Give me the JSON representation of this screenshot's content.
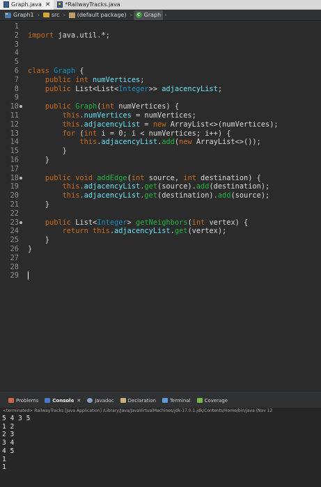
{
  "window": {
    "tabs": [
      {
        "label": "Graph.java",
        "icon": "java-file-icon",
        "active": true
      },
      {
        "label": "*RailwayTracks.java",
        "icon": "java-file-icon",
        "active": false
      }
    ]
  },
  "breadcrumb": [
    "Graph1",
    "src",
    "(default package)",
    "Graph"
  ],
  "editor": {
    "line_numbers": [
      "1",
      "2",
      "3",
      "4",
      "5",
      "6",
      "7",
      "8",
      "9",
      "10",
      "11",
      "12",
      "13",
      "14",
      "15",
      "16",
      "17",
      "18",
      "19",
      "20",
      "21",
      "22",
      "23",
      "24",
      "25",
      "26",
      "27",
      "28",
      "29"
    ],
    "lines": [
      [],
      [
        [
          "kw",
          "import"
        ],
        [
          "t",
          " java.util.*;"
        ]
      ],
      [],
      [],
      [],
      [
        [
          "kw",
          "class"
        ],
        [
          "t",
          " "
        ],
        [
          "typ",
          "Graph"
        ],
        [
          "t",
          " {"
        ]
      ],
      [
        [
          "t",
          "    "
        ],
        [
          "kw",
          "public"
        ],
        [
          "t",
          " "
        ],
        [
          "kw",
          "int"
        ],
        [
          "t",
          " "
        ],
        [
          "fld",
          "numVertices"
        ],
        [
          "t",
          ";"
        ]
      ],
      [
        [
          "t",
          "    "
        ],
        [
          "kw",
          "public"
        ],
        [
          "t",
          " List<List<"
        ],
        [
          "typ",
          "Integer"
        ],
        [
          "t",
          ">> "
        ],
        [
          "fld",
          "adjacencyList"
        ],
        [
          "t",
          ";"
        ]
      ],
      [],
      [
        [
          "t",
          "    "
        ],
        [
          "kw",
          "public"
        ],
        [
          "t",
          " "
        ],
        [
          "mth",
          "Graph"
        ],
        [
          "t",
          "("
        ],
        [
          "kw",
          "int"
        ],
        [
          "t",
          " numVertices) {"
        ]
      ],
      [
        [
          "t",
          "        "
        ],
        [
          "kw",
          "this"
        ],
        [
          "t",
          "."
        ],
        [
          "fld",
          "numVertices"
        ],
        [
          "t",
          " = numVertices;"
        ]
      ],
      [
        [
          "t",
          "        "
        ],
        [
          "kw",
          "this"
        ],
        [
          "t",
          "."
        ],
        [
          "fld",
          "adjacencyList"
        ],
        [
          "t",
          " = "
        ],
        [
          "kw",
          "new"
        ],
        [
          "t",
          " ArrayList<>(numVertices);"
        ]
      ],
      [
        [
          "t",
          "        "
        ],
        [
          "kw",
          "for"
        ],
        [
          "t",
          " ("
        ],
        [
          "kw",
          "int"
        ],
        [
          "t",
          " i = 0; i < numVertices; i++) {"
        ]
      ],
      [
        [
          "t",
          "            "
        ],
        [
          "kw",
          "this"
        ],
        [
          "t",
          "."
        ],
        [
          "fld",
          "adjacencyList"
        ],
        [
          "t",
          "."
        ],
        [
          "mth",
          "add"
        ],
        [
          "t",
          "("
        ],
        [
          "kw",
          "new"
        ],
        [
          "t",
          " ArrayList<>());"
        ]
      ],
      [
        [
          "t",
          "        }"
        ]
      ],
      [
        [
          "t",
          "    }"
        ]
      ],
      [],
      [
        [
          "t",
          "    "
        ],
        [
          "kw",
          "public"
        ],
        [
          "t",
          " "
        ],
        [
          "kw",
          "void"
        ],
        [
          "t",
          " "
        ],
        [
          "mth",
          "addEdge"
        ],
        [
          "t",
          "("
        ],
        [
          "kw",
          "int"
        ],
        [
          "t",
          " source, "
        ],
        [
          "kw",
          "int"
        ],
        [
          "t",
          " destination) {"
        ]
      ],
      [
        [
          "t",
          "        "
        ],
        [
          "kw",
          "this"
        ],
        [
          "t",
          "."
        ],
        [
          "fld",
          "adjacencyList"
        ],
        [
          "t",
          "."
        ],
        [
          "mth",
          "get"
        ],
        [
          "t",
          "(source)."
        ],
        [
          "mth",
          "add"
        ],
        [
          "t",
          "(destination);"
        ]
      ],
      [
        [
          "t",
          "        "
        ],
        [
          "kw",
          "this"
        ],
        [
          "t",
          "."
        ],
        [
          "fld",
          "adjacencyList"
        ],
        [
          "t",
          "."
        ],
        [
          "mth",
          "get"
        ],
        [
          "t",
          "(destination)."
        ],
        [
          "mth",
          "add"
        ],
        [
          "t",
          "(source);"
        ]
      ],
      [
        [
          "t",
          "    }"
        ]
      ],
      [],
      [
        [
          "t",
          "    "
        ],
        [
          "kw",
          "public"
        ],
        [
          "t",
          " List<"
        ],
        [
          "typ",
          "Integer"
        ],
        [
          "t",
          "> "
        ],
        [
          "mth",
          "getNeighbors"
        ],
        [
          "t",
          "("
        ],
        [
          "kw",
          "int"
        ],
        [
          "t",
          " vertex) {"
        ]
      ],
      [
        [
          "t",
          "        "
        ],
        [
          "kw",
          "return"
        ],
        [
          "t",
          " "
        ],
        [
          "kw",
          "this"
        ],
        [
          "t",
          "."
        ],
        [
          "fld",
          "adjacencyList"
        ],
        [
          "t",
          "."
        ],
        [
          "mth",
          "get"
        ],
        [
          "t",
          "(vertex);"
        ]
      ],
      [
        [
          "t",
          "    }"
        ]
      ],
      [
        [
          "t",
          "}"
        ]
      ],
      [],
      [],
      []
    ],
    "fold_markers": [
      10,
      18,
      23
    ],
    "caret_line": 29
  },
  "console": {
    "tabs": [
      {
        "label": "Problems",
        "icon": "problems-icon",
        "active": false
      },
      {
        "label": "Console",
        "icon": "console-icon",
        "active": true
      },
      {
        "label": "Javadoc",
        "icon": "javadoc-icon",
        "active": false
      },
      {
        "label": "Declaration",
        "icon": "declaration-icon",
        "active": false
      },
      {
        "label": "Terminal",
        "icon": "terminal-icon",
        "active": false
      },
      {
        "label": "Coverage",
        "icon": "coverage-icon",
        "active": false
      }
    ],
    "status": "<terminated> RailwayTracks [Java Application] /Library/Java/JavaVirtualMachines/jdk-17.0.1.jdk/Contents/Home/bin/java  (Nov 12",
    "output": [
      "5 4 3 5",
      "1 2",
      "2 3",
      "3 4",
      "4 5",
      "1",
      "1"
    ]
  },
  "colors": {
    "keyword": "#cc6c1d",
    "field": "#66e1f8",
    "type": "#1290c3",
    "method": "#1eb540",
    "editor_bg": "#2b2b2b"
  }
}
